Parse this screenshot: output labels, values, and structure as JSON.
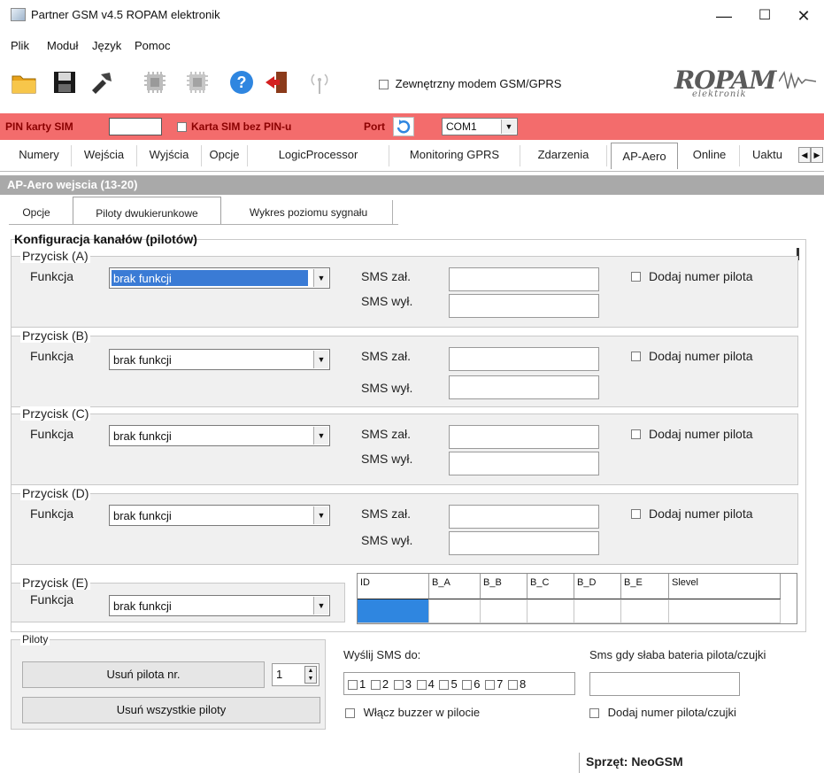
{
  "window": {
    "title": "Partner GSM v4.5 ROPAM elektronik",
    "controls": [
      "—",
      "☐",
      "✕"
    ]
  },
  "menu": [
    "Plik",
    "Moduł",
    "Język",
    "Pomoc"
  ],
  "toolbar": {
    "icons": [
      "folder-icon",
      "save-icon",
      "tools-icon",
      "chip-icon",
      "chip2-icon",
      "help-icon",
      "exit-icon",
      "antenna-icon"
    ],
    "external_modem_label": "Zewnętrzny modem GSM/GPRS",
    "logo_text": "ROPAM",
    "logo_subtext": "elektronik"
  },
  "pinbar": {
    "pin_label": "PIN karty SIM",
    "pin_value": "",
    "no_pin_label": "Karta SIM bez PIN-u",
    "port_label": "Port",
    "port_value": "COM1"
  },
  "main_tabs": [
    "Numery",
    "Wejścia",
    "Wyjścia",
    "Opcje",
    "LogicProcessor",
    "Monitoring GPRS",
    "Zdarzenia",
    "AP-Aero",
    "Online",
    "Uaktu"
  ],
  "section_header": "AP-Aero  wejscia  (13-20)",
  "sub_tabs": [
    "Opcje",
    "Piloty dwukierunkowe",
    "Wykres poziomu sygnału"
  ],
  "config": {
    "title": "Konfiguracja kanałów (pilotów)",
    "function_label": "Funkcja",
    "sms_on_label": "SMS zał.",
    "sms_off_label": "SMS wył.",
    "add_remote_number_label": "Dodaj numer pilota",
    "buttons": [
      {
        "name": "Przycisk (A)",
        "function": "brak funkcji",
        "sms_on": "",
        "sms_off": ""
      },
      {
        "name": "Przycisk (B)",
        "function": "brak funkcji",
        "sms_on": "",
        "sms_off": ""
      },
      {
        "name": "Przycisk (C)",
        "function": "brak funkcji",
        "sms_on": "",
        "sms_off": ""
      },
      {
        "name": "Przycisk (D)",
        "function": "brak funkcji",
        "sms_on": "",
        "sms_off": ""
      },
      {
        "name": "Przycisk (E)",
        "function": "brak funkcji"
      }
    ]
  },
  "grid": {
    "columns": [
      "ID",
      "B_A",
      "B_B",
      "B_C",
      "B_D",
      "B_E",
      "Slevel"
    ]
  },
  "piloty": {
    "legend": "Piloty",
    "remove_nr_label": "Usuń pilota nr.",
    "remove_nr_value": "1",
    "remove_all_label": "Usuń wszystkie piloty"
  },
  "send_sms": {
    "label": "Wyślij SMS do:",
    "numbers": [
      "1",
      "2",
      "3",
      "4",
      "5",
      "6",
      "7",
      "8"
    ],
    "buzzer_label": "Włącz buzzer w pilocie"
  },
  "low_battery": {
    "label": "Sms gdy słaba bateria pilota/czujki",
    "value": "",
    "add_number_label": "Dodaj numer pilota/czujki"
  },
  "hardware": "Sprzęt: NeoGSM"
}
